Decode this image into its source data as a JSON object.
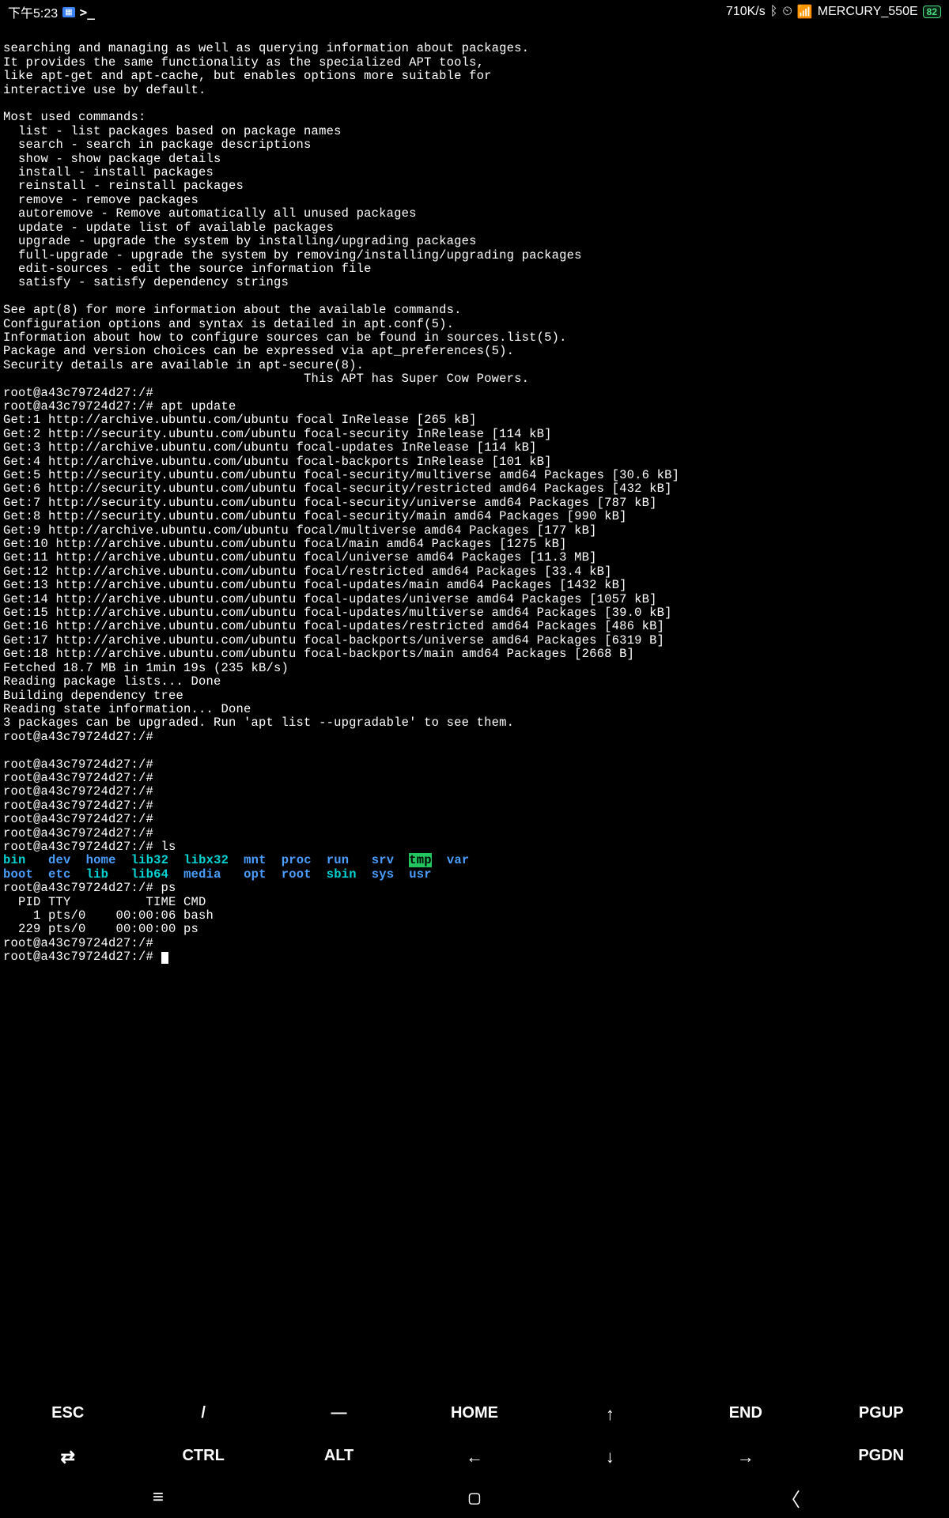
{
  "status": {
    "time": "下午5:23",
    "speed": "710K/s",
    "wifi_name": "MERCURY_550E",
    "battery": "82"
  },
  "terminal_lines": {
    "l1": "searching and managing as well as querying information about packages.",
    "l2": "It provides the same functionality as the specialized APT tools,",
    "l3": "like apt-get and apt-cache, but enables options more suitable for",
    "l4": "interactive use by default.",
    "l5": "",
    "l6": "Most used commands:",
    "l7": "  list - list packages based on package names",
    "l8": "  search - search in package descriptions",
    "l9": "  show - show package details",
    "l10": "  install - install packages",
    "l11": "  reinstall - reinstall packages",
    "l12": "  remove - remove packages",
    "l13": "  autoremove - Remove automatically all unused packages",
    "l14": "  update - update list of available packages",
    "l15": "  upgrade - upgrade the system by installing/upgrading packages",
    "l16": "  full-upgrade - upgrade the system by removing/installing/upgrading packages",
    "l17": "  edit-sources - edit the source information file",
    "l18": "  satisfy - satisfy dependency strings",
    "l19": "",
    "l20": "See apt(8) for more information about the available commands.",
    "l21": "Configuration options and syntax is detailed in apt.conf(5).",
    "l22": "Information about how to configure sources can be found in sources.list(5).",
    "l23": "Package and version choices can be expressed via apt_preferences(5).",
    "l24": "Security details are available in apt-secure(8).",
    "l25": "                                        This APT has Super Cow Powers.",
    "l26": "root@a43c79724d27:/#",
    "l27": "root@a43c79724d27:/# apt update",
    "l28": "Get:1 http://archive.ubuntu.com/ubuntu focal InRelease [265 kB]",
    "l29": "Get:2 http://security.ubuntu.com/ubuntu focal-security InRelease [114 kB]",
    "l30": "Get:3 http://archive.ubuntu.com/ubuntu focal-updates InRelease [114 kB]",
    "l31": "Get:4 http://archive.ubuntu.com/ubuntu focal-backports InRelease [101 kB]",
    "l32": "Get:5 http://security.ubuntu.com/ubuntu focal-security/multiverse amd64 Packages [30.6 kB]",
    "l33": "Get:6 http://security.ubuntu.com/ubuntu focal-security/restricted amd64 Packages [432 kB]",
    "l34": "Get:7 http://security.ubuntu.com/ubuntu focal-security/universe amd64 Packages [787 kB]",
    "l35": "Get:8 http://security.ubuntu.com/ubuntu focal-security/main amd64 Packages [990 kB]",
    "l36": "Get:9 http://archive.ubuntu.com/ubuntu focal/multiverse amd64 Packages [177 kB]",
    "l37": "Get:10 http://archive.ubuntu.com/ubuntu focal/main amd64 Packages [1275 kB]",
    "l38": "Get:11 http://archive.ubuntu.com/ubuntu focal/universe amd64 Packages [11.3 MB]",
    "l39": "Get:12 http://archive.ubuntu.com/ubuntu focal/restricted amd64 Packages [33.4 kB]",
    "l40": "Get:13 http://archive.ubuntu.com/ubuntu focal-updates/main amd64 Packages [1432 kB]",
    "l41": "Get:14 http://archive.ubuntu.com/ubuntu focal-updates/universe amd64 Packages [1057 kB]",
    "l42": "Get:15 http://archive.ubuntu.com/ubuntu focal-updates/multiverse amd64 Packages [39.0 kB]",
    "l43": "Get:16 http://archive.ubuntu.com/ubuntu focal-updates/restricted amd64 Packages [486 kB]",
    "l44": "Get:17 http://archive.ubuntu.com/ubuntu focal-backports/universe amd64 Packages [6319 B]",
    "l45": "Get:18 http://archive.ubuntu.com/ubuntu focal-backports/main amd64 Packages [2668 B]",
    "l46": "Fetched 18.7 MB in 1min 19s (235 kB/s)",
    "l47": "Reading package lists... Done",
    "l48": "Building dependency tree",
    "l49": "Reading state information... Done",
    "l50": "3 packages can be upgraded. Run 'apt list --upgradable' to see them.",
    "l51": "root@a43c79724d27:/#",
    "l52": "",
    "l53": "root@a43c79724d27:/#",
    "l54": "root@a43c79724d27:/#",
    "l55": "root@a43c79724d27:/#",
    "l56": "root@a43c79724d27:/#",
    "l57": "root@a43c79724d27:/#",
    "l58": "root@a43c79724d27:/#",
    "l59": "root@a43c79724d27:/# ls",
    "ls_row1": {
      "bin": "bin",
      "dev": "dev",
      "home": "home",
      "lib32": "lib32",
      "libx32": "libx32",
      "mnt": "mnt",
      "proc": "proc",
      "run": "run",
      "srv": "srv",
      "tmp": "tmp",
      "var": "var"
    },
    "ls_row2": {
      "boot": "boot",
      "etc": "etc",
      "lib": "lib",
      "lib64": "lib64",
      "media": "media",
      "opt": "opt",
      "root": "root",
      "sbin": "sbin",
      "sys": "sys",
      "usr": "usr"
    },
    "l62": "root@a43c79724d27:/# ps",
    "l63": "  PID TTY          TIME CMD",
    "l64": "    1 pts/0    00:00:06 bash",
    "l65": "  229 pts/0    00:00:00 ps",
    "l66": "root@a43c79724d27:/#",
    "l67": "root@a43c79724d27:/# "
  },
  "keys": {
    "row1": {
      "k1": "ESC",
      "k2": "/",
      "k3": "―",
      "k4": "HOME",
      "k5": "↑",
      "k6": "END",
      "k7": "PGUP"
    },
    "row2": {
      "k1": "⇄",
      "k2": "CTRL",
      "k3": "ALT",
      "k4": "←",
      "k5": "↓",
      "k6": "→",
      "k7": "PGDN"
    }
  }
}
